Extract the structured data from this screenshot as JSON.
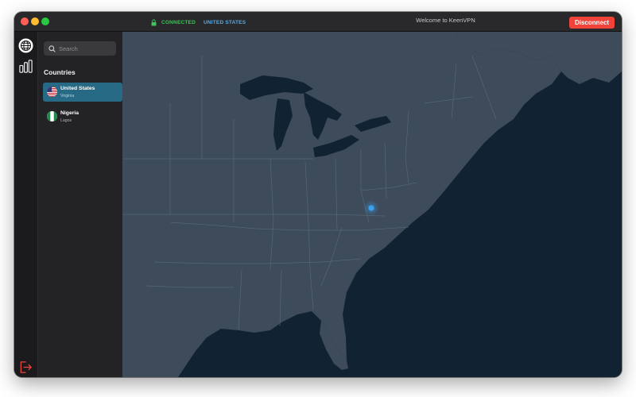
{
  "app": {
    "window_title": "Welcome to KeenVPN",
    "status": {
      "connection": "CONNECTED",
      "country": "UNITED STATES"
    },
    "disconnect_label": "Disconnect"
  },
  "rail": {
    "icons": [
      "globe-icon",
      "stats-icon",
      "logout-icon"
    ]
  },
  "sidebar": {
    "search": {
      "placeholder": "Search",
      "value": ""
    },
    "heading": "Countries",
    "countries": [
      {
        "name": "United States",
        "city": "Virginia",
        "selected": true,
        "flag": "us-flag"
      },
      {
        "name": "Nigeria",
        "city": "Lagos",
        "selected": false,
        "flag": "nigeria-flag"
      }
    ]
  },
  "map": {
    "region": "Eastern United States",
    "active_location": "Virginia",
    "colors": {
      "water": "#112233",
      "land": "#3d4b5b",
      "border": "#56677a",
      "marker": "#3aa0f0"
    }
  },
  "colors": {
    "accent": "#266a86",
    "connected": "#3ec45a",
    "country": "#5aa9e6",
    "danger": "#f2433b"
  }
}
